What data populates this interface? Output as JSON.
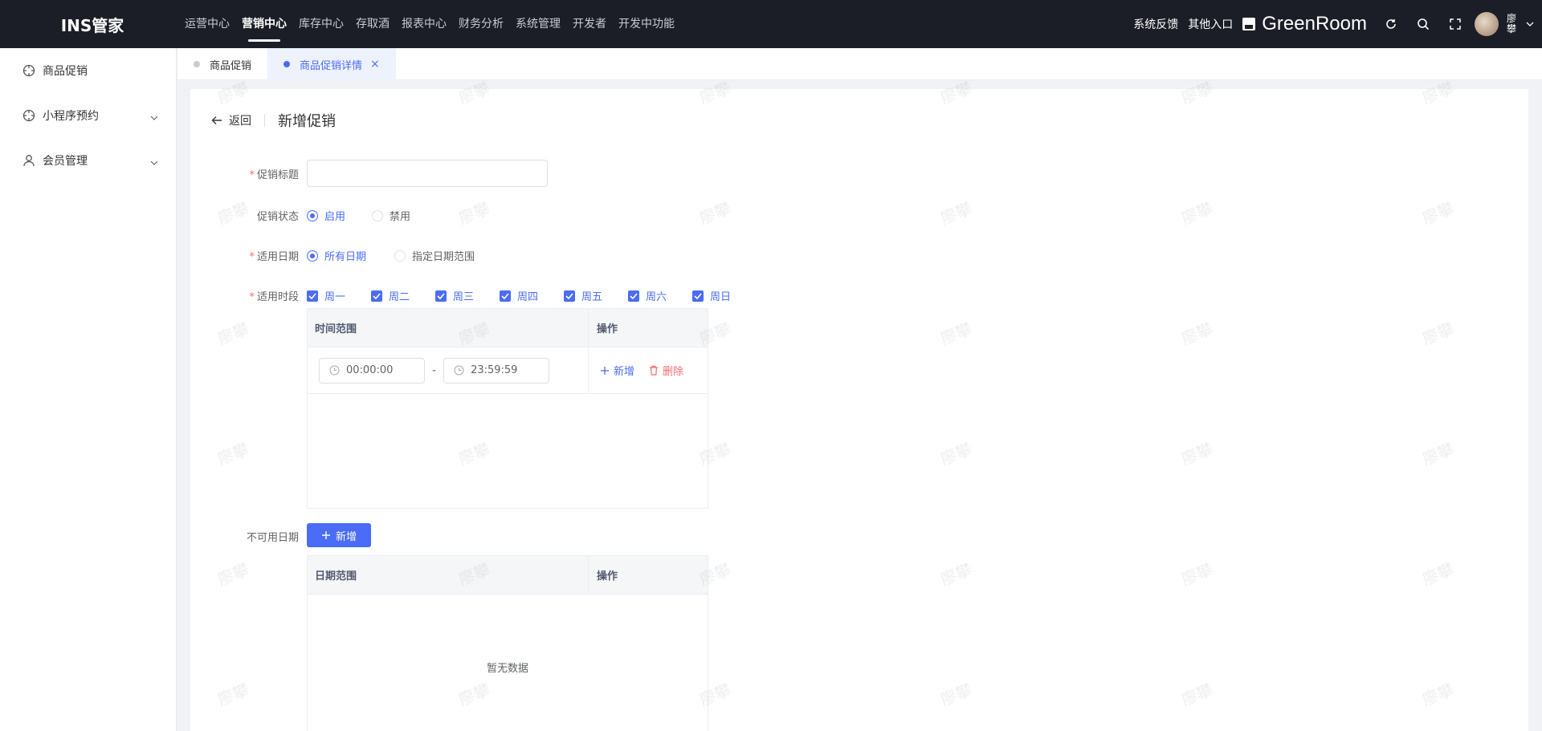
{
  "app": {
    "title": "INS管家"
  },
  "nav": {
    "items": [
      {
        "label": "运营中心",
        "active": false
      },
      {
        "label": "营销中心",
        "active": true
      },
      {
        "label": "库存中心",
        "active": false
      },
      {
        "label": "存取酒",
        "active": false
      },
      {
        "label": "报表中心",
        "active": false
      },
      {
        "label": "财务分析",
        "active": false
      },
      {
        "label": "系统管理",
        "active": false
      },
      {
        "label": "开发者",
        "active": false
      },
      {
        "label": "开发中功能",
        "active": false
      }
    ]
  },
  "header_right": {
    "feedback": "系统反馈",
    "other_entry": "其他入口",
    "store_name": "GreenRoom",
    "user_name": "廖攀"
  },
  "sidebar": {
    "items": [
      {
        "label": "商品促销",
        "icon": "target-icon"
      },
      {
        "label": "小程序预约",
        "icon": "target-icon",
        "expandable": true
      },
      {
        "label": "会员管理",
        "icon": "user-icon",
        "expandable": true
      }
    ]
  },
  "tabs": [
    {
      "label": "商品促销",
      "active": false
    },
    {
      "label": "商品促销详情",
      "active": true,
      "close": "×"
    }
  ],
  "page": {
    "back_label": "返回",
    "title": "新增促销"
  },
  "form": {
    "title_label": "促销标题",
    "title_value": "",
    "status_label": "促销状态",
    "status_options": [
      "启用",
      "禁用"
    ],
    "status_selected": "启用",
    "date_label": "适用日期",
    "date_options": [
      "所有日期",
      "指定日期范围"
    ],
    "date_selected": "所有日期",
    "period_label": "适用时段",
    "weekdays": [
      "周一",
      "周二",
      "周三",
      "周四",
      "周五",
      "周六",
      "周日"
    ],
    "time_table": {
      "col_range": "时间范围",
      "col_action": "操作",
      "rows": [
        {
          "start": "00:00:00",
          "end": "23:59:59"
        }
      ],
      "separator": "-",
      "add_label": "新增",
      "delete_label": "删除"
    },
    "unavailable_label": "不可用日期",
    "add_button": "新增",
    "date_table": {
      "col_range": "日期范围",
      "col_action": "操作",
      "empty_text": "暂无数据"
    }
  },
  "watermark": "廖攀",
  "colors": {
    "accent": "#4a6cf7",
    "danger": "#f56c6c",
    "topbar": "#1b1d27"
  }
}
